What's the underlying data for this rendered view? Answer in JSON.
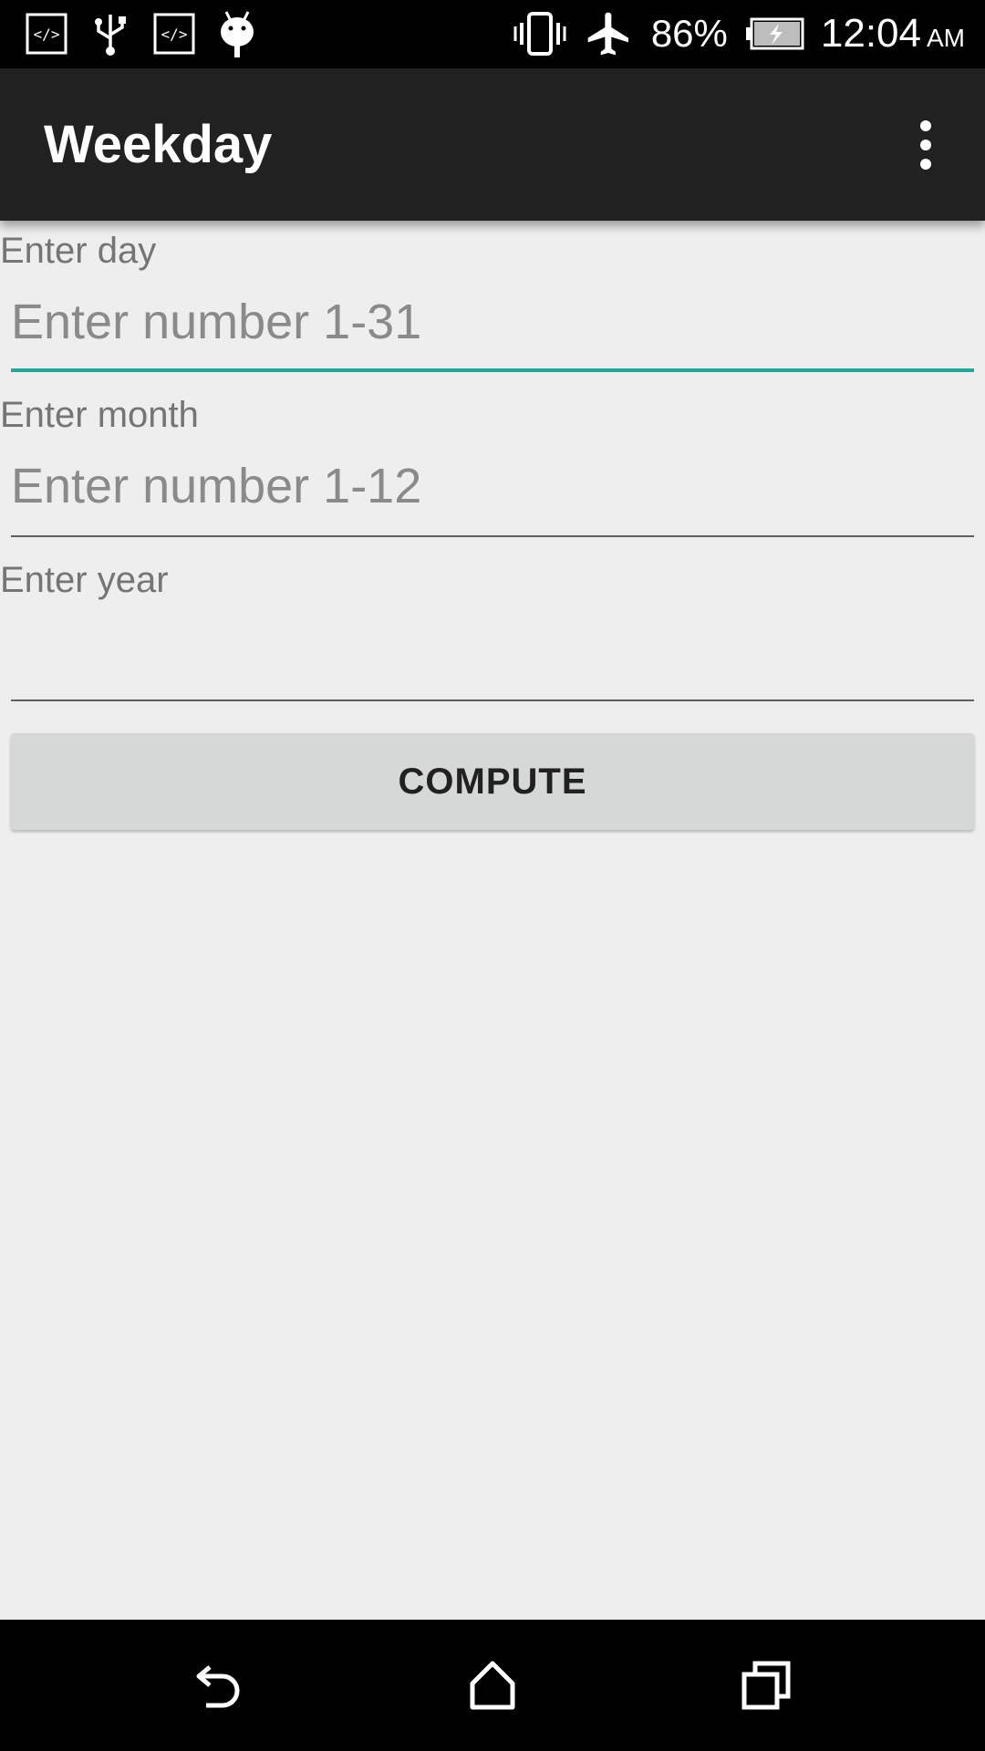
{
  "status_bar": {
    "left_icons": [
      "code-icon",
      "usb-icon",
      "code-icon",
      "android-debug-icon"
    ],
    "right_icons": [
      "vibrate-icon",
      "airplane-mode-icon",
      "battery-charging-icon"
    ],
    "battery_percent": "86%",
    "time": "12:04",
    "ampm": "AM"
  },
  "app_bar": {
    "title": "Weekday",
    "overflow_icon": "more-vert-icon"
  },
  "form": {
    "day": {
      "label": "Enter day",
      "placeholder": "Enter number 1-31",
      "value": ""
    },
    "month": {
      "label": "Enter month",
      "placeholder": "Enter number 1-12",
      "value": ""
    },
    "year": {
      "label": "Enter year",
      "placeholder": "",
      "value": ""
    },
    "compute_label": "COMPUTE",
    "accent_color": "#26a69a"
  },
  "nav_bar": {
    "icons": [
      "back-icon",
      "home-icon",
      "recents-icon"
    ]
  }
}
